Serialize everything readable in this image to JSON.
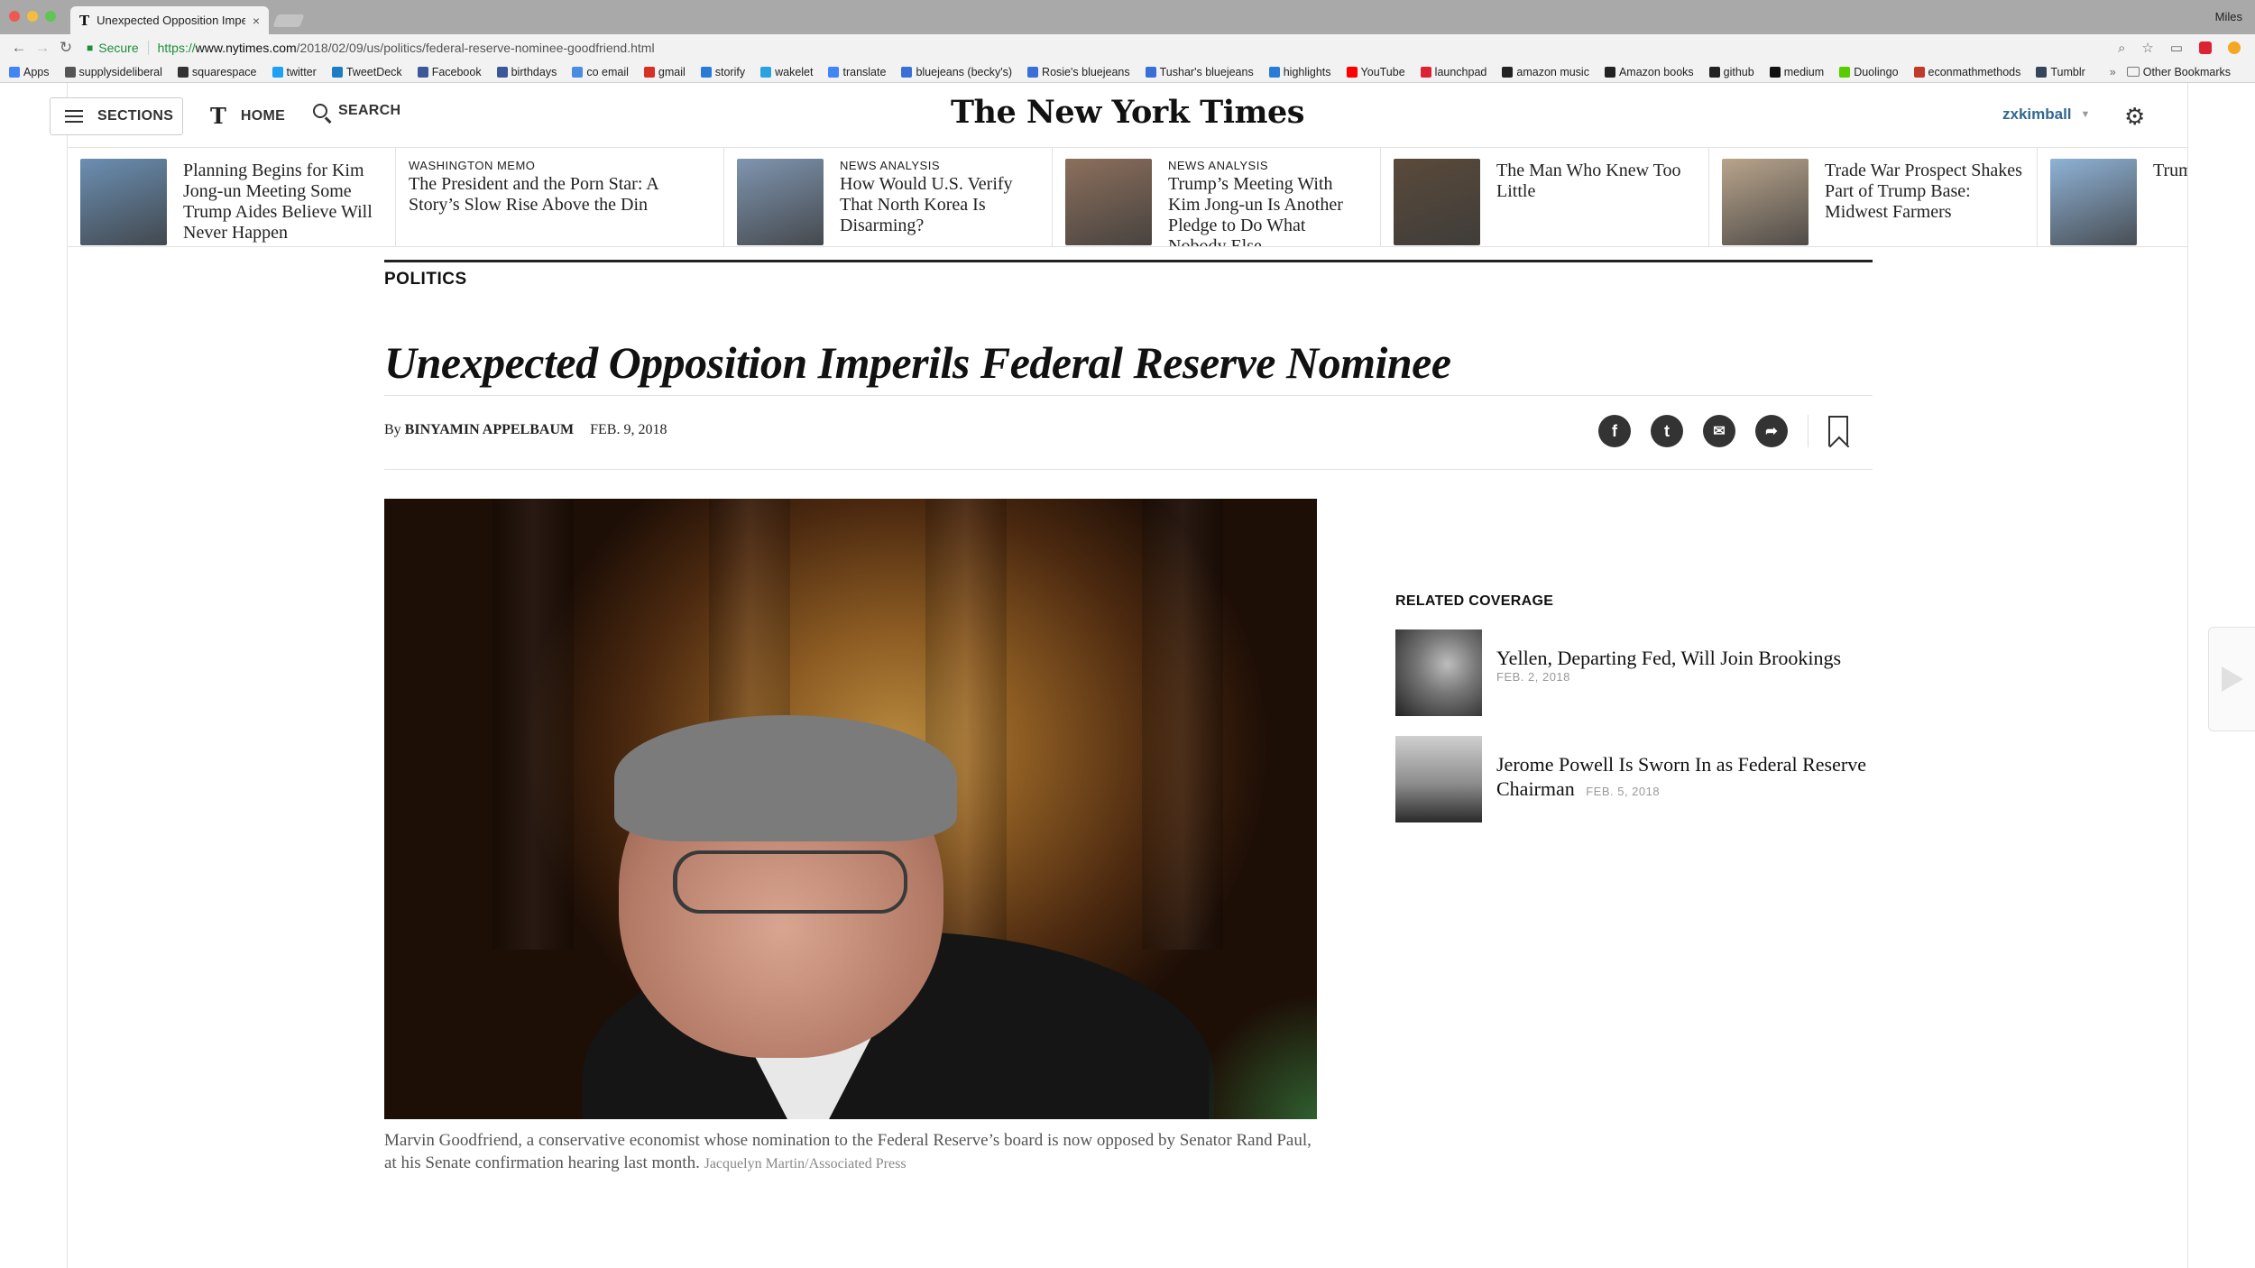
{
  "browser": {
    "tab_title": "Unexpected Opposition Imperi",
    "profile_name": "Miles",
    "secure_label": "Secure",
    "url_prefix": "https://",
    "url_host": "www.nytimes.com",
    "url_path": "/2018/02/09/us/politics/federal-reserve-nominee-goodfriend.html",
    "bookmarks": [
      {
        "label": "Apps",
        "color": "#4285f4"
      },
      {
        "label": "supplysideliberal",
        "color": "#555555"
      },
      {
        "label": "squarespace",
        "color": "#333333"
      },
      {
        "label": "twitter",
        "color": "#1da1f2"
      },
      {
        "label": "TweetDeck",
        "color": "#1d7cc4"
      },
      {
        "label": "Facebook",
        "color": "#3b5998"
      },
      {
        "label": "birthdays",
        "color": "#3b5998"
      },
      {
        "label": "co email",
        "color": "#4a8ce0"
      },
      {
        "label": "gmail",
        "color": "#d93025"
      },
      {
        "label": "storify",
        "color": "#2a7bd8"
      },
      {
        "label": "wakelet",
        "color": "#2aa2e0"
      },
      {
        "label": "translate",
        "color": "#4285f4"
      },
      {
        "label": "bluejeans (becky's)",
        "color": "#3a6fd8"
      },
      {
        "label": "Rosie's bluejeans",
        "color": "#3a6fd8"
      },
      {
        "label": "Tushar's bluejeans",
        "color": "#3a6fd8"
      },
      {
        "label": "highlights",
        "color": "#2a7bd8"
      },
      {
        "label": "YouTube",
        "color": "#ff0000"
      },
      {
        "label": "launchpad",
        "color": "#d23"
      },
      {
        "label": "amazon music",
        "color": "#222222"
      },
      {
        "label": "Amazon books",
        "color": "#222222"
      },
      {
        "label": "github",
        "color": "#222222"
      },
      {
        "label": "medium",
        "color": "#111111"
      },
      {
        "label": "Duolingo",
        "color": "#58cc02"
      },
      {
        "label": "econmathmethods",
        "color": "#c0392b"
      },
      {
        "label": "Tumblr",
        "color": "#35465c"
      }
    ],
    "more_label": "»",
    "other_bookmarks": "Other Bookmarks"
  },
  "masthead": {
    "sections_label": "SECTIONS",
    "home_label": "HOME",
    "search_label": "SEARCH",
    "logo_text": "The New York Times",
    "username": "zxkimball"
  },
  "ribbon": [
    {
      "kicker": "",
      "headline": "Planning Begins for Kim Jong-un Meeting Some Trump Aides Believe Will Never Happen",
      "thumb_color": "#6b8fb3"
    },
    {
      "kicker": "WASHINGTON MEMO",
      "headline": "The President and the Porn Star: A Story’s Slow Rise Above the Din",
      "thumb_color": ""
    },
    {
      "kicker": "NEWS ANALYSIS",
      "headline": "How Would U.S. Verify That North Korea Is Disarming?",
      "thumb_color": "#7f95b0"
    },
    {
      "kicker": "NEWS ANALYSIS",
      "headline": "Trump’s Meeting With Kim Jong-un Is Another Pledge to Do What Nobody Else...",
      "thumb_color": "#8c6f5c"
    },
    {
      "kicker": "",
      "headline": "The Man Who Knew Too Little",
      "thumb_color": "#5a4a3a"
    },
    {
      "kicker": "",
      "headline": "Trade War Prospect Shakes Part of Trump Base: Midwest Farmers",
      "thumb_color": "#b9a48c"
    },
    {
      "kicker": "",
      "headline": "Trum Plans Plan",
      "thumb_color": "#8fb2d6"
    }
  ],
  "article": {
    "section": "POLITICS",
    "headline": "Unexpected Opposition Imperils Federal Reserve Nominee",
    "by": "By",
    "author": "BINYAMIN APPELBAUM",
    "date": "FEB. 9, 2018",
    "caption": "Marvin Goodfriend, a conservative economist whose nomination to the Federal Reserve’s board is now opposed by Senator Rand Paul, at his Senate confirmation hearing last month.",
    "credit": "Jacquelyn Martin/Associated Press"
  },
  "related": {
    "title": "RELATED COVERAGE",
    "items": [
      {
        "headline": "Yellen, Departing Fed, Will Join Brookings",
        "date": "FEB. 2, 2018"
      },
      {
        "headline": "Jerome Powell Is Sworn In as Federal Reserve Chairman",
        "date": "FEB. 5, 2018"
      }
    ]
  },
  "icons": {
    "facebook": "f",
    "twitter": "t",
    "email": "✉",
    "share": "➦",
    "gear": "⚙"
  }
}
